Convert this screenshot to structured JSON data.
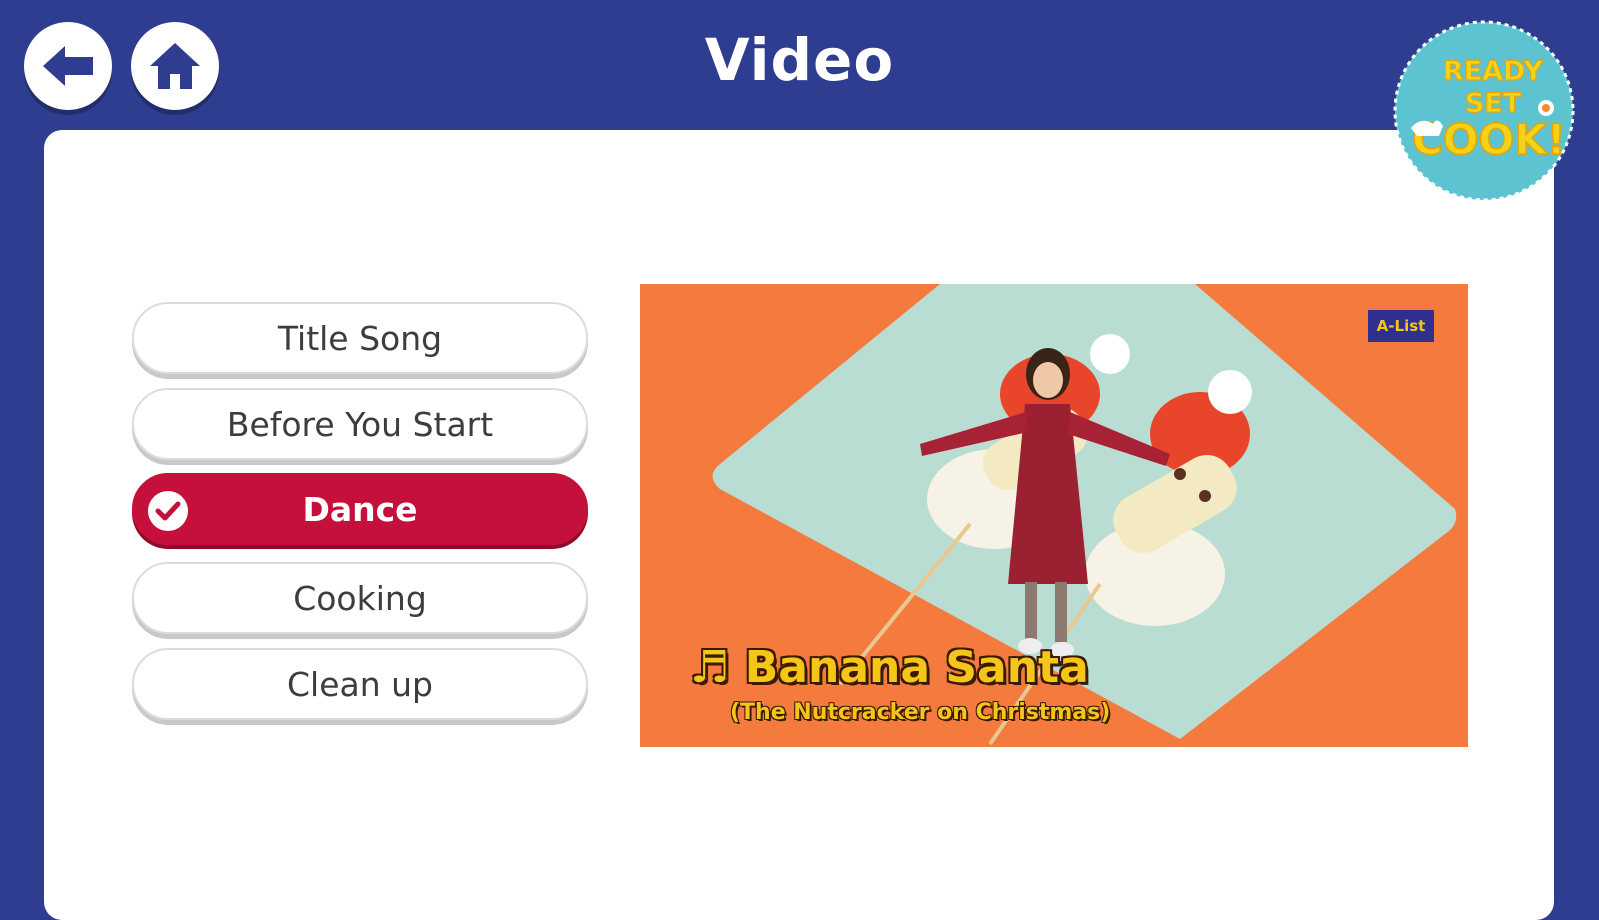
{
  "header": {
    "title": "Video",
    "back_icon": "back-arrow-icon",
    "home_icon": "home-icon"
  },
  "logo": {
    "line1": "READY",
    "line2": "SET",
    "line3": "COOK!"
  },
  "menu": {
    "items": [
      {
        "label": "Title Song",
        "active": false
      },
      {
        "label": "Before You Start",
        "active": false
      },
      {
        "label": "Dance",
        "active": true
      },
      {
        "label": "Cooking",
        "active": false
      },
      {
        "label": "Clean up",
        "active": false
      }
    ]
  },
  "video": {
    "badge": "A-List",
    "title": "♬ Banana Santa",
    "subtitle": "(The Nutcracker on Christmas)"
  },
  "colors": {
    "background": "#2e3d8f",
    "active": "#c4103a",
    "video_bg": "#f47a3e",
    "title_yellow": "#f5c518"
  }
}
